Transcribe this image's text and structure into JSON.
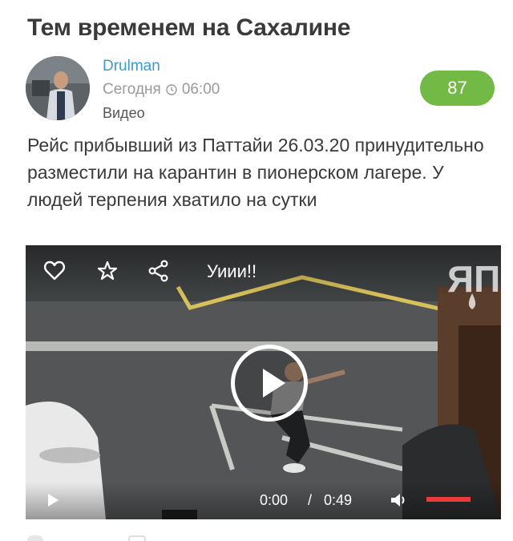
{
  "post": {
    "title": "Тем временем на Сахалине",
    "author": "Drulman",
    "date": "Сегодня",
    "time": "06:00",
    "category": "Видео",
    "rating": "87",
    "text": "Рейс прибывший из Паттайи 26.03.20 принудительно разместили на карантин в пионерском лагере. У людей терпения хватило на сутки"
  },
  "video": {
    "caption": "Уиии!!",
    "logo_text": "ЯП",
    "current_time": "0:00",
    "separator": "/",
    "duration": "0:49",
    "icons": [
      "heart-icon",
      "star-icon",
      "share-icon",
      "play-icon",
      "volume-icon",
      "clock-icon"
    ]
  },
  "colors": {
    "author": "#3b9ad1",
    "rating_bg": "#72b945",
    "volume_bar": "#e83a3a"
  }
}
